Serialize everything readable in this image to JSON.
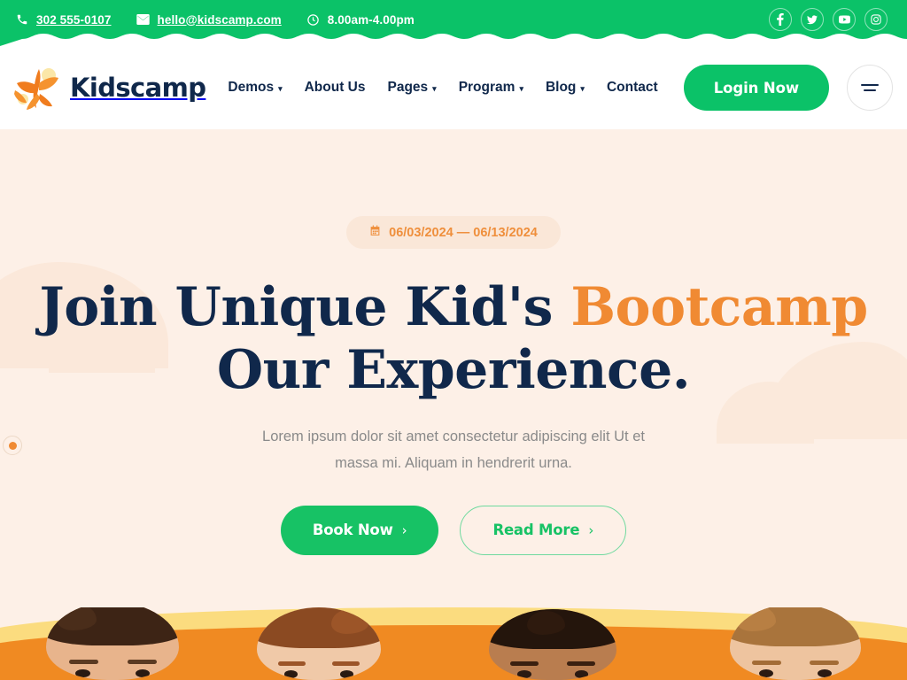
{
  "topbar": {
    "phone": "302 555-0107",
    "email": "hello@kidscamp.com",
    "hours": "8.00am-4.00pm",
    "phone_icon": "phone-icon",
    "email_icon": "envelope-icon",
    "hours_icon": "clock-icon",
    "socials": [
      {
        "name": "facebook-icon",
        "glyph": "f"
      },
      {
        "name": "twitter-icon",
        "glyph": "t"
      },
      {
        "name": "youtube-icon",
        "glyph": "y"
      },
      {
        "name": "instagram-icon",
        "glyph": "i"
      }
    ],
    "bg_color": "#0bc268"
  },
  "header": {
    "brand_name": "Kidscamp",
    "brand_icon": "kidscamp-logo-icon",
    "nav": [
      {
        "label": "Demos",
        "has_caret": true
      },
      {
        "label": "About Us",
        "has_caret": false
      },
      {
        "label": "Pages",
        "has_caret": true
      },
      {
        "label": "Program",
        "has_caret": true
      },
      {
        "label": "Blog",
        "has_caret": true
      },
      {
        "label": "Contact",
        "has_caret": false
      }
    ],
    "login_label": "Login Now",
    "menu_icon": "hamburger-menu-icon",
    "nav_color": "#10284b"
  },
  "hero": {
    "date_badge": "06/03/2024 — 06/13/2024",
    "date_icon": "calendar-icon",
    "headline_line1_a": "Join Unique Kid's ",
    "headline_line1_accent": "Bootcamp",
    "headline_line2": "Our Experience.",
    "subtitle_line1": "Lorem ipsum dolor sit amet consectetur adipiscing elit Ut et",
    "subtitle_line2": "massa mi. Aliquam in hendrerit urna.",
    "primary_cta": "Book Now",
    "secondary_cta": "Read More",
    "chevron": "›",
    "accent_color": "#f08a33",
    "heading_color": "#10284b",
    "bg_color": "#fdf0e7"
  },
  "carousel": {
    "indicator_name": "slide-indicator-dot"
  },
  "footer_band": {
    "yellow": "#fbdc7f",
    "orange": "#f08a22",
    "kids_alt": "children-photo-band"
  }
}
